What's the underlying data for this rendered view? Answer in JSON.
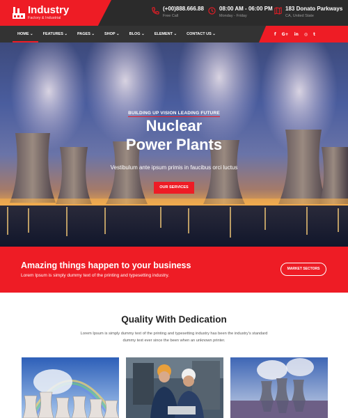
{
  "logo": {
    "title": "Industry",
    "subtitle": "Factory & Industrial"
  },
  "header_info": [
    {
      "icon": "phone-icon",
      "title": "(+00)888.666.88",
      "subtitle": "Free Call"
    },
    {
      "icon": "clock-icon",
      "title": "08:00 AM - 06:00 PM",
      "subtitle": "Monday - Friday"
    },
    {
      "icon": "map-icon",
      "title": "183 Donato Parkways",
      "subtitle": "CA, United State"
    }
  ],
  "nav": {
    "items": [
      "HOME",
      "FEATURES",
      "PAGES",
      "SHOP",
      "BLOG",
      "ELEMENT",
      "CONTACT US"
    ],
    "active": "HOME"
  },
  "social": [
    "facebook-icon",
    "google-plus-icon",
    "linkedin-icon",
    "instagram-icon",
    "twitter-icon"
  ],
  "social_glyphs": [
    "f",
    "G+",
    "in",
    "◎",
    "t"
  ],
  "hero": {
    "kicker": "BUILDING UP VISION LEADING FUTURE",
    "title_line1": "Nuclear",
    "title_line2": "Power Plants",
    "subtitle": "Vestibulum ante ipsum primis in faucibus orci luctus",
    "button": "OUR SERVICES"
  },
  "cta": {
    "title": "Amazing things happen to your business",
    "subtitle": "Lorem Ipsum is simply dummy text of the printing and typesetting industry.",
    "button": "MARKET SECTORS"
  },
  "quality": {
    "title": "Quality With Dedication",
    "text": "Lorem Ipsum is simply dummy text of the printing and typesetting industry has been the industry's standard dummy text ever since the been when an unknown printer."
  },
  "colors": {
    "accent": "#ee1c25",
    "dark": "#2b2b2b",
    "nav": "#333333"
  }
}
